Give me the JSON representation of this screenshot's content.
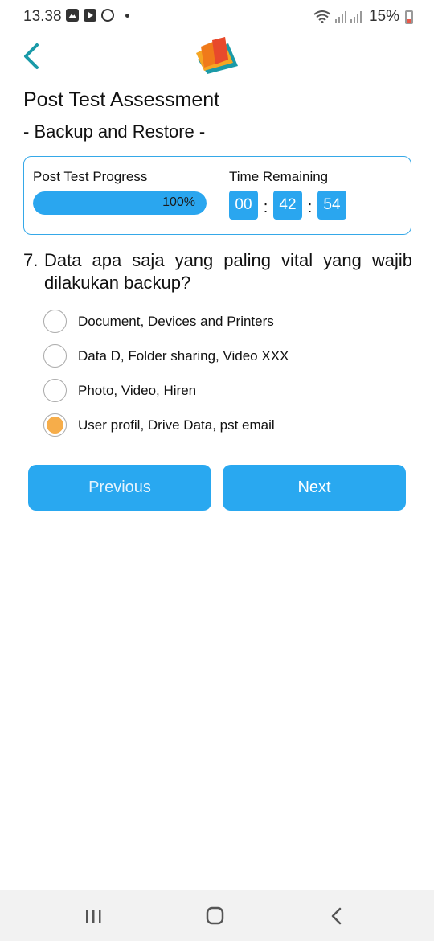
{
  "status_bar": {
    "time": "13.38",
    "icons": [
      "gallery-icon",
      "youtube-icon",
      "sync-icon",
      "dot-icon",
      "wifi-icon",
      "signal-icon",
      "signal-icon",
      "battery-icon"
    ],
    "battery_percent": "15%"
  },
  "header": {
    "back_icon": "chevron-left-icon",
    "logo_icon": "book-logo-icon",
    "accent_color": "#1a9aa8"
  },
  "page": {
    "title": "Post Test Assessment",
    "subtitle": "- Backup and Restore -"
  },
  "progress_panel": {
    "progress_label": "Post Test Progress",
    "progress_fraction": 1.0,
    "progress_text": "100%",
    "time_label": "Time Remaining",
    "timer": {
      "hours": "00",
      "minutes": "42",
      "seconds": "54",
      "separator": ":"
    }
  },
  "question": {
    "number": "7.",
    "text": "Data apa saja yang paling vital yang wajib dilakukan backup?",
    "options": [
      {
        "label": "Document, Devices and Printers",
        "selected": false
      },
      {
        "label": "Data D, Folder sharing, Video XXX",
        "selected": false
      },
      {
        "label": "Photo, Video, Hiren",
        "selected": false
      },
      {
        "label": "User profil, Drive Data, pst email",
        "selected": true
      }
    ]
  },
  "buttons": {
    "previous_label": "Previous",
    "next_label": "Next"
  },
  "nav_bar": {
    "icons": [
      "recent-apps-icon",
      "home-icon",
      "back-icon"
    ]
  },
  "colors": {
    "primary": "#29a8f0",
    "selected_radio": "#f6ad4a",
    "panel_border": "#35a8e8"
  }
}
